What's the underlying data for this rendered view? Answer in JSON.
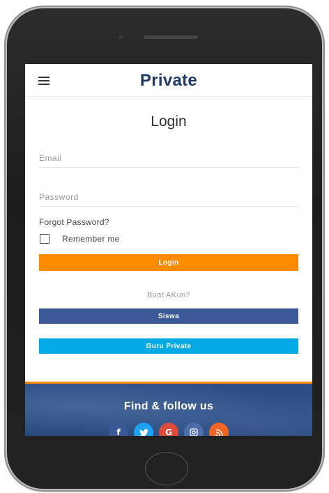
{
  "header": {
    "brand": "Private",
    "menu_icon": "hamburger-icon"
  },
  "login": {
    "title": "Login",
    "email_placeholder": "Email",
    "password_placeholder": "Password",
    "forgot_label": "Forgot Password?",
    "remember_label": "Remember me",
    "login_button": "Login"
  },
  "register": {
    "prompt": "Buat AKun?",
    "siswa_button": "Siswa",
    "guru_button": "Guru Private"
  },
  "footer": {
    "title": "Find & follow us",
    "social": [
      {
        "icon": "facebook-icon",
        "glyph": "f",
        "color": "#3b5998"
      },
      {
        "icon": "twitter-icon",
        "glyph": "🐦",
        "color": "#1da1f2"
      },
      {
        "icon": "google-plus-icon",
        "glyph": "G",
        "color": "#dd4b39"
      },
      {
        "icon": "instagram-icon",
        "glyph": "◎",
        "color": "#4f6ea8"
      },
      {
        "icon": "rss-icon",
        "glyph": "◗",
        "color": "#f26522"
      }
    ]
  },
  "colors": {
    "brand": "#1e3a6b",
    "login_button": "#ff8c00",
    "siswa_button": "#3b5998",
    "guru_button": "#03a9e4",
    "footer_bg": "#2d4f84"
  }
}
